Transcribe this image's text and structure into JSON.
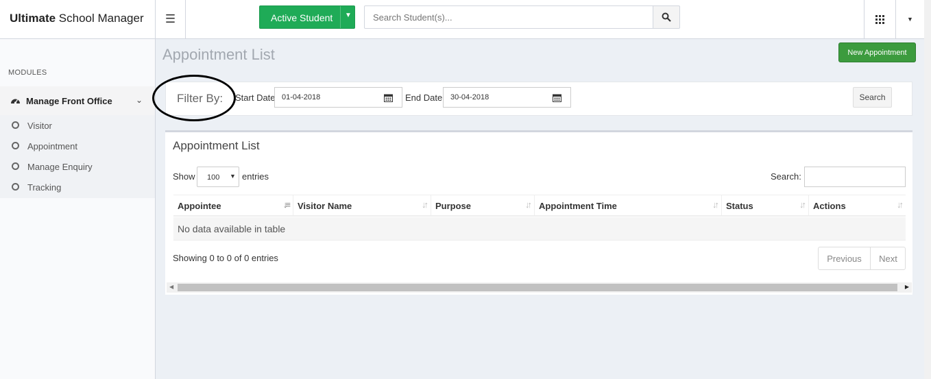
{
  "header": {
    "brand_bold": "Ultimate",
    "brand_rest": " School Manager",
    "active_student_label": "Active Student",
    "search_placeholder": "Search Student(s)...",
    "accent_color": "#1fab57"
  },
  "sidebar": {
    "modules_label": "MODULES",
    "group_label": "Manage Front Office",
    "items": [
      {
        "label": "Visitor"
      },
      {
        "label": "Appointment"
      },
      {
        "label": "Manage Enquiry"
      },
      {
        "label": "Tracking"
      }
    ]
  },
  "page": {
    "title": "Appointment List",
    "new_button_label": "New Appointment"
  },
  "filter": {
    "label": "Filter By:",
    "start_label": "Start Date:",
    "start_value": "01-04-2018",
    "end_label": "End Date:",
    "end_value": "30-04-2018",
    "search_label": "Search"
  },
  "list": {
    "title": "Appointment List",
    "show_label": "Show",
    "entries_value": "100",
    "entries_label": "entries",
    "search_label": "Search:",
    "columns": [
      "Appointee",
      "Visitor Name",
      "Purpose",
      "Appointment Time",
      "Status",
      "Actions"
    ],
    "empty_text": "No data available in table",
    "info_text": "Showing 0 to 0 of 0 entries",
    "prev_label": "Previous",
    "next_label": "Next"
  }
}
